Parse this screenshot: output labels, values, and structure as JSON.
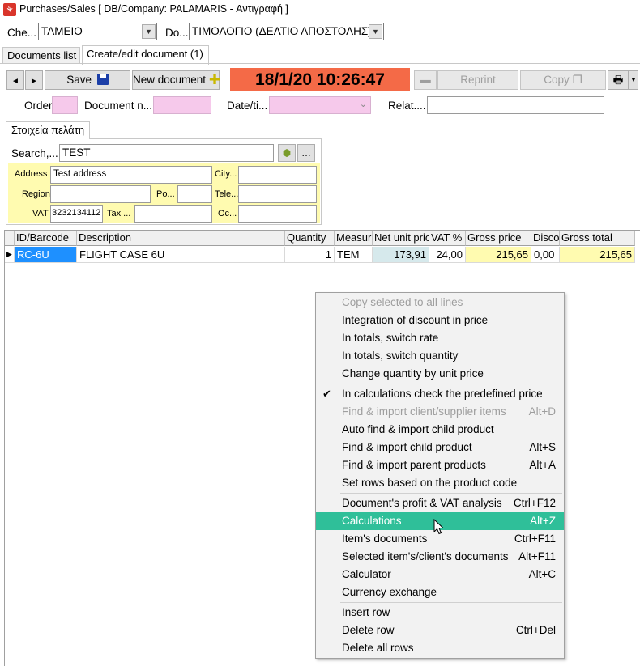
{
  "window": {
    "title": "Purchases/Sales  [ DB/Company: PALAMARIS - Αντιγραφή ]",
    "icon": "app-logo-icon"
  },
  "top": {
    "checkout_label": "Che...",
    "checkout_value": "ΤΑΜΕΙΟ",
    "document_label": "Do...",
    "document_value": "ΤΙΜΟΛΟΓΙΟ (ΔΕΛΤΙΟ ΑΠΟΣΤΟΛΗΣ)"
  },
  "tabs": [
    {
      "label": "Documents list",
      "active": false
    },
    {
      "label": "Create/edit document (1)",
      "active": true
    }
  ],
  "toolbar": {
    "prev": "◄",
    "next": "►",
    "save_label": "Save",
    "new_doc_label": "New document",
    "datetime": "18/1/20 10:26:47",
    "reprint_label": "Reprint",
    "copy_label": "Copy"
  },
  "header_fields": {
    "order_label": "Order",
    "docno_label": "Document n...",
    "date_label": "Date/ti...",
    "relat_label": "Relat...."
  },
  "customer": {
    "tab_label": "Στοιχεία πελάτη",
    "search_label": "Search,...",
    "search_value": "TEST",
    "address_label": "Address",
    "address_value": "Test address",
    "city_label": "City...",
    "region_label": "Region",
    "po_label": "Po...",
    "tele_label": "Tele...",
    "vat_label": "VAT",
    "vat_value": "3232134112",
    "tax_label": "Tax ...",
    "oc_label": "Oc..."
  },
  "grid": {
    "columns": [
      "ID/Barcode",
      "Description",
      "Quantity",
      "Measur",
      "Net unit pric",
      "VAT %",
      "Gross price",
      "Disco",
      "Gross total"
    ],
    "rows": [
      [
        "RC-6U",
        "FLIGHT CASE 6U",
        "1",
        "TEM",
        "173,91",
        "24,00",
        "215,65",
        "0,00",
        "215,65"
      ]
    ]
  },
  "context_menu": {
    "items": [
      {
        "label": "Copy selected to all lines",
        "shortcut": "",
        "disabled": true
      },
      {
        "label": "Integration of discount in price",
        "shortcut": ""
      },
      {
        "label": "In totals, switch rate",
        "shortcut": ""
      },
      {
        "label": "In totals, switch quantity",
        "shortcut": ""
      },
      {
        "label": "Change quantity by unit price",
        "shortcut": ""
      },
      {
        "label": "In calculations check the predefined price",
        "shortcut": "",
        "checked": true
      },
      {
        "label": "Find & import client/supplier items",
        "shortcut": "Alt+D",
        "disabled": true
      },
      {
        "label": "Auto find & import child product",
        "shortcut": ""
      },
      {
        "label": "Find & import child product",
        "shortcut": "Alt+S"
      },
      {
        "label": "Find & import parent products",
        "shortcut": "Alt+A"
      },
      {
        "label": "Set rows based on the product code",
        "shortcut": ""
      },
      {
        "label": "Document's profit & VAT analysis",
        "shortcut": "Ctrl+F12"
      },
      {
        "label": "Calculations",
        "shortcut": "Alt+Z",
        "highlighted": true
      },
      {
        "label": "Item's documents",
        "shortcut": "Ctrl+F11"
      },
      {
        "label": "Selected item's/client's documents",
        "shortcut": "Alt+F11"
      },
      {
        "label": "Calculator",
        "shortcut": "Alt+C"
      },
      {
        "label": "Currency exchange",
        "shortcut": ""
      },
      {
        "label": "Insert row",
        "shortcut": ""
      },
      {
        "label": "Delete row",
        "shortcut": "Ctrl+Del"
      },
      {
        "label": "Delete all rows",
        "shortcut": ""
      }
    ]
  },
  "colors": {
    "datetime_bg": "#f46a47",
    "pink_field": "#f6c9eb",
    "yellow_area": "#fffbb0",
    "menu_highlight": "#2fbf99",
    "selected_cell": "#1e90ff"
  }
}
